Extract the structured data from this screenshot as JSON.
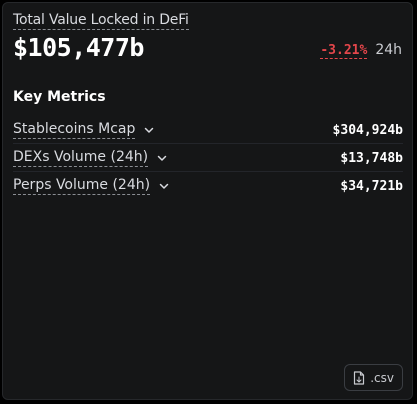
{
  "tvl": {
    "label": "Total Value Locked in DeFi",
    "value": "$105,477b",
    "change": "-3.21%",
    "period": "24h"
  },
  "key_metrics": {
    "heading": "Key Metrics",
    "rows": [
      {
        "label": "Stablecoins Mcap",
        "value": "$304,924b"
      },
      {
        "label": "DEXs Volume (24h)",
        "value": "$13,748b"
      },
      {
        "label": "Perps Volume (24h)",
        "value": "$34,721b"
      }
    ]
  },
  "download": {
    "label": ".csv",
    "icon": "file-icon"
  },
  "colors": {
    "background": "#151617",
    "negative": "#e4464b",
    "text": "#ffffff"
  }
}
